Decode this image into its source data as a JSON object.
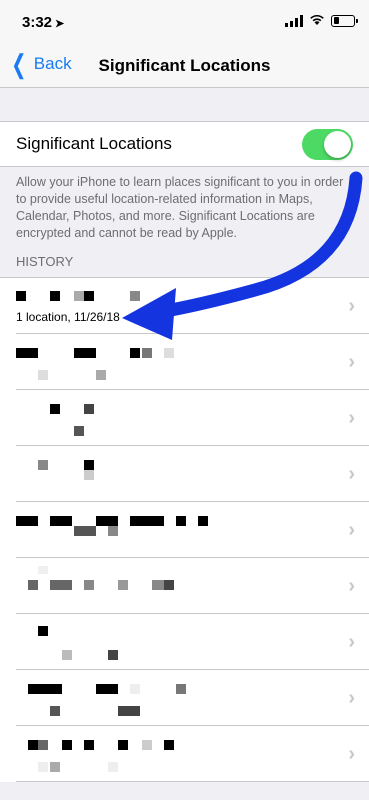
{
  "status_bar": {
    "time": "3:32",
    "battery_level": 0.3
  },
  "nav": {
    "back_label": "Back",
    "title": "Significant Locations"
  },
  "setting": {
    "label": "Significant Locations",
    "enabled": true,
    "description": "Allow your iPhone to learn places significant to you in order to provide useful location-related information in Maps, Calendar, Photos, and more. Significant Locations are encrypted and cannot be read by Apple."
  },
  "history": {
    "header": "HISTORY",
    "first_item_subtitle": "1 location, 11/26/18",
    "row_count": 9
  },
  "colors": {
    "accent": "#1a7bf2",
    "switch_on": "#4cd964",
    "arrow": "#1434e0"
  }
}
